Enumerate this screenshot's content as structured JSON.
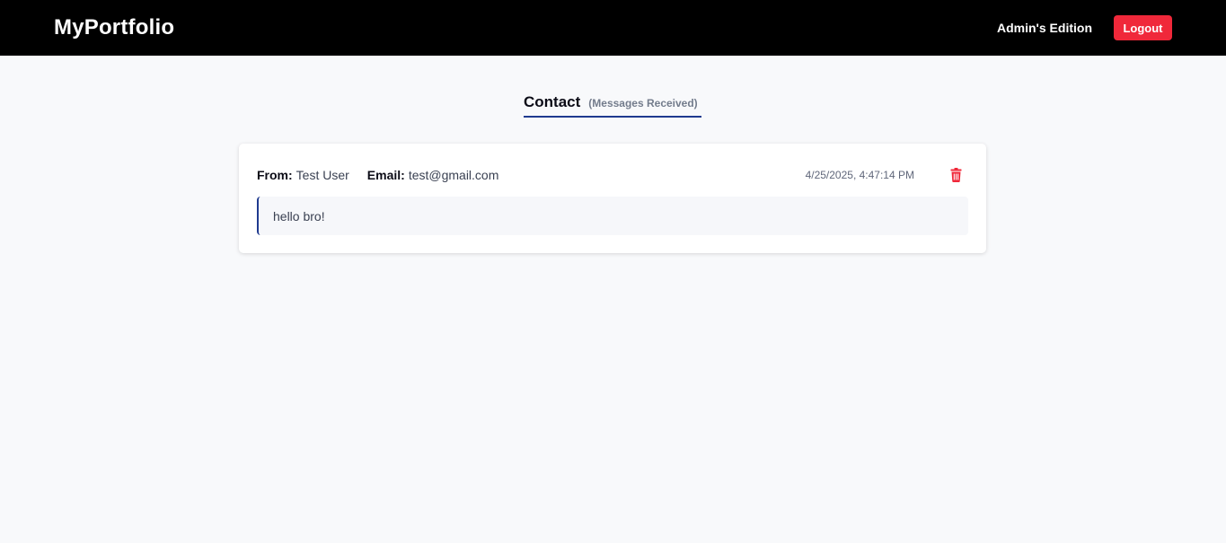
{
  "navbar": {
    "brand": "MyPortfolio",
    "edition_label": "Admin's Edition",
    "logout_label": "Logout"
  },
  "section": {
    "title": "Contact",
    "subtitle": "(Messages Received)"
  },
  "messages": [
    {
      "from_label": "From:",
      "from_value": "Test User",
      "email_label": "Email:",
      "email_value": "test@gmail.com",
      "timestamp": "4/25/2025, 4:47:14 PM",
      "body": "hello bro!",
      "delete_icon": "trash-icon"
    }
  ],
  "colors": {
    "navbar_bg": "#000000",
    "accent": "#1f3a8f",
    "danger": "#f0283a",
    "page_bg": "#f8f9fb"
  }
}
